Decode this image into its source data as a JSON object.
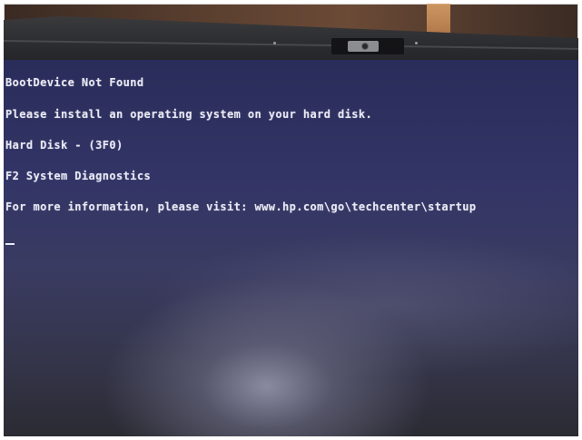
{
  "boot_screen": {
    "lines": [
      "BootDevice Not Found",
      "Please install an operating system on your hard disk.",
      "Hard Disk - (3F0)",
      "F2 System Diagnostics",
      "For more information, please visit: www.hp.com\\go\\techcenter\\startup"
    ],
    "cursor": "_"
  },
  "colors": {
    "screen_background": "#323466",
    "text": "#e8e8f4",
    "bezel": "#2d2e31"
  },
  "icons": [
    "webcam-privacy-slider-icon",
    "webcam-lens-icon"
  ]
}
